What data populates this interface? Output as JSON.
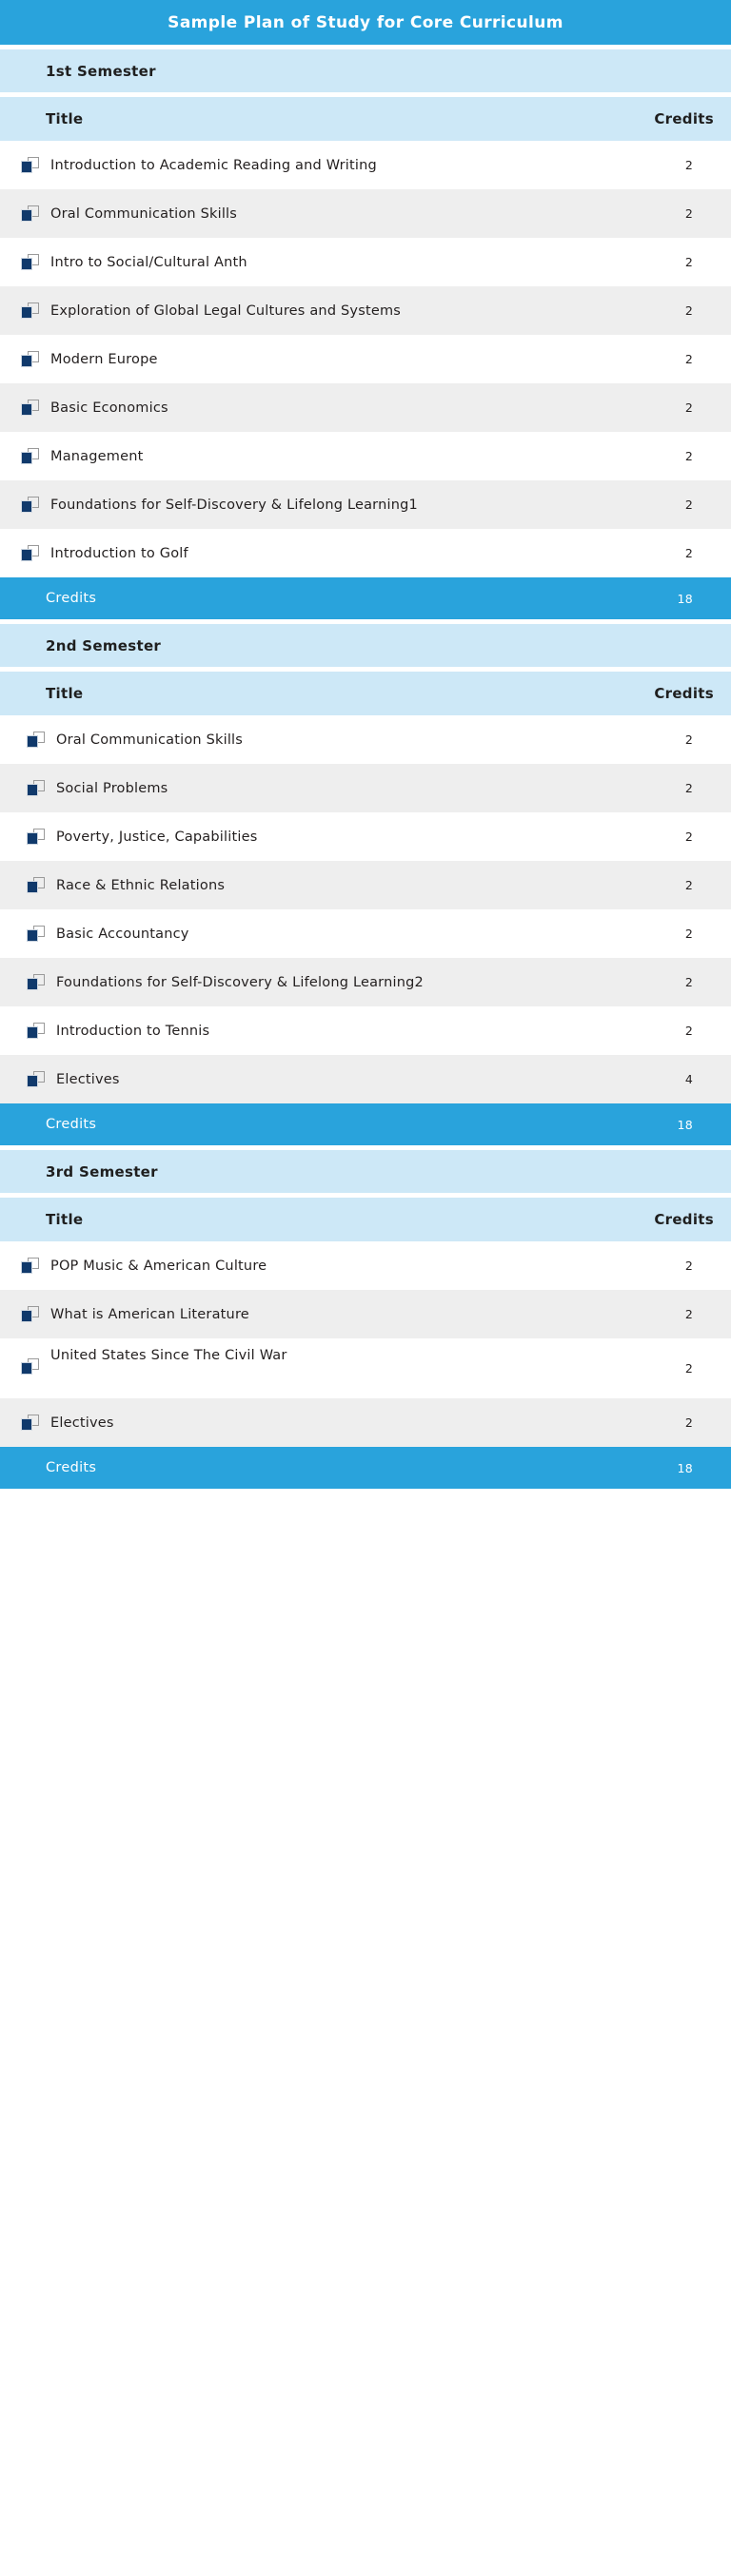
{
  "page": {
    "title": "Sample Plan of Study for Core Curriculum",
    "accent_color": "#29a3dc",
    "band_color": "#cde8f7",
    "alt_row_color": "#eeeeee",
    "icon_color": "#10396b",
    "row_icon_name": "course-stacked-squares-icon"
  },
  "columns": {
    "title_label": "Title",
    "credits_label": "Credits"
  },
  "credits_row_label": "Credits",
  "semesters": [
    {
      "name": "1st Semester",
      "courses": [
        {
          "title": "Introduction to Academic Reading and Writing",
          "credits": "2"
        },
        {
          "title": "Oral Communication Skills",
          "credits": "2"
        },
        {
          "title": "Intro to Social/Cultural Anth",
          "credits": "2"
        },
        {
          "title": "Exploration of Global Legal Cultures and Systems",
          "credits": "2"
        },
        {
          "title": "Modern Europe",
          "credits": "2"
        },
        {
          "title": "Basic Economics",
          "credits": "2"
        },
        {
          "title": "Management",
          "credits": "2"
        },
        {
          "title": "Foundations for Self-Discovery & Lifelong Learning1",
          "credits": "2"
        },
        {
          "title": "Introduction to Golf",
          "credits": "2"
        }
      ],
      "total_credits": "18"
    },
    {
      "name": "2nd Semester",
      "courses": [
        {
          "title": "Oral Communication Skills",
          "credits": "2"
        },
        {
          "title": "Social Problems",
          "credits": "2"
        },
        {
          "title": "Poverty, Justice, Capabilities",
          "credits": "2"
        },
        {
          "title": "Race & Ethnic Relations",
          "credits": "2"
        },
        {
          "title": "Basic Accountancy",
          "credits": "2"
        },
        {
          "title": "Foundations for Self-Discovery & Lifelong Learning2",
          "credits": "2"
        },
        {
          "title": "Introduction to Tennis",
          "credits": "2"
        },
        {
          "title": "Electives",
          "credits": "4"
        }
      ],
      "total_credits": "18"
    },
    {
      "name": "3rd Semester",
      "courses": [
        {
          "title": "POP Music & American Culture",
          "credits": "2"
        },
        {
          "title": "What is American Literature",
          "credits": "2"
        },
        {
          "title": "United States Since The Civil War",
          "credits": "2",
          "tall": true
        },
        {
          "title": "Electives",
          "credits": "2"
        }
      ],
      "total_credits": "18"
    }
  ]
}
